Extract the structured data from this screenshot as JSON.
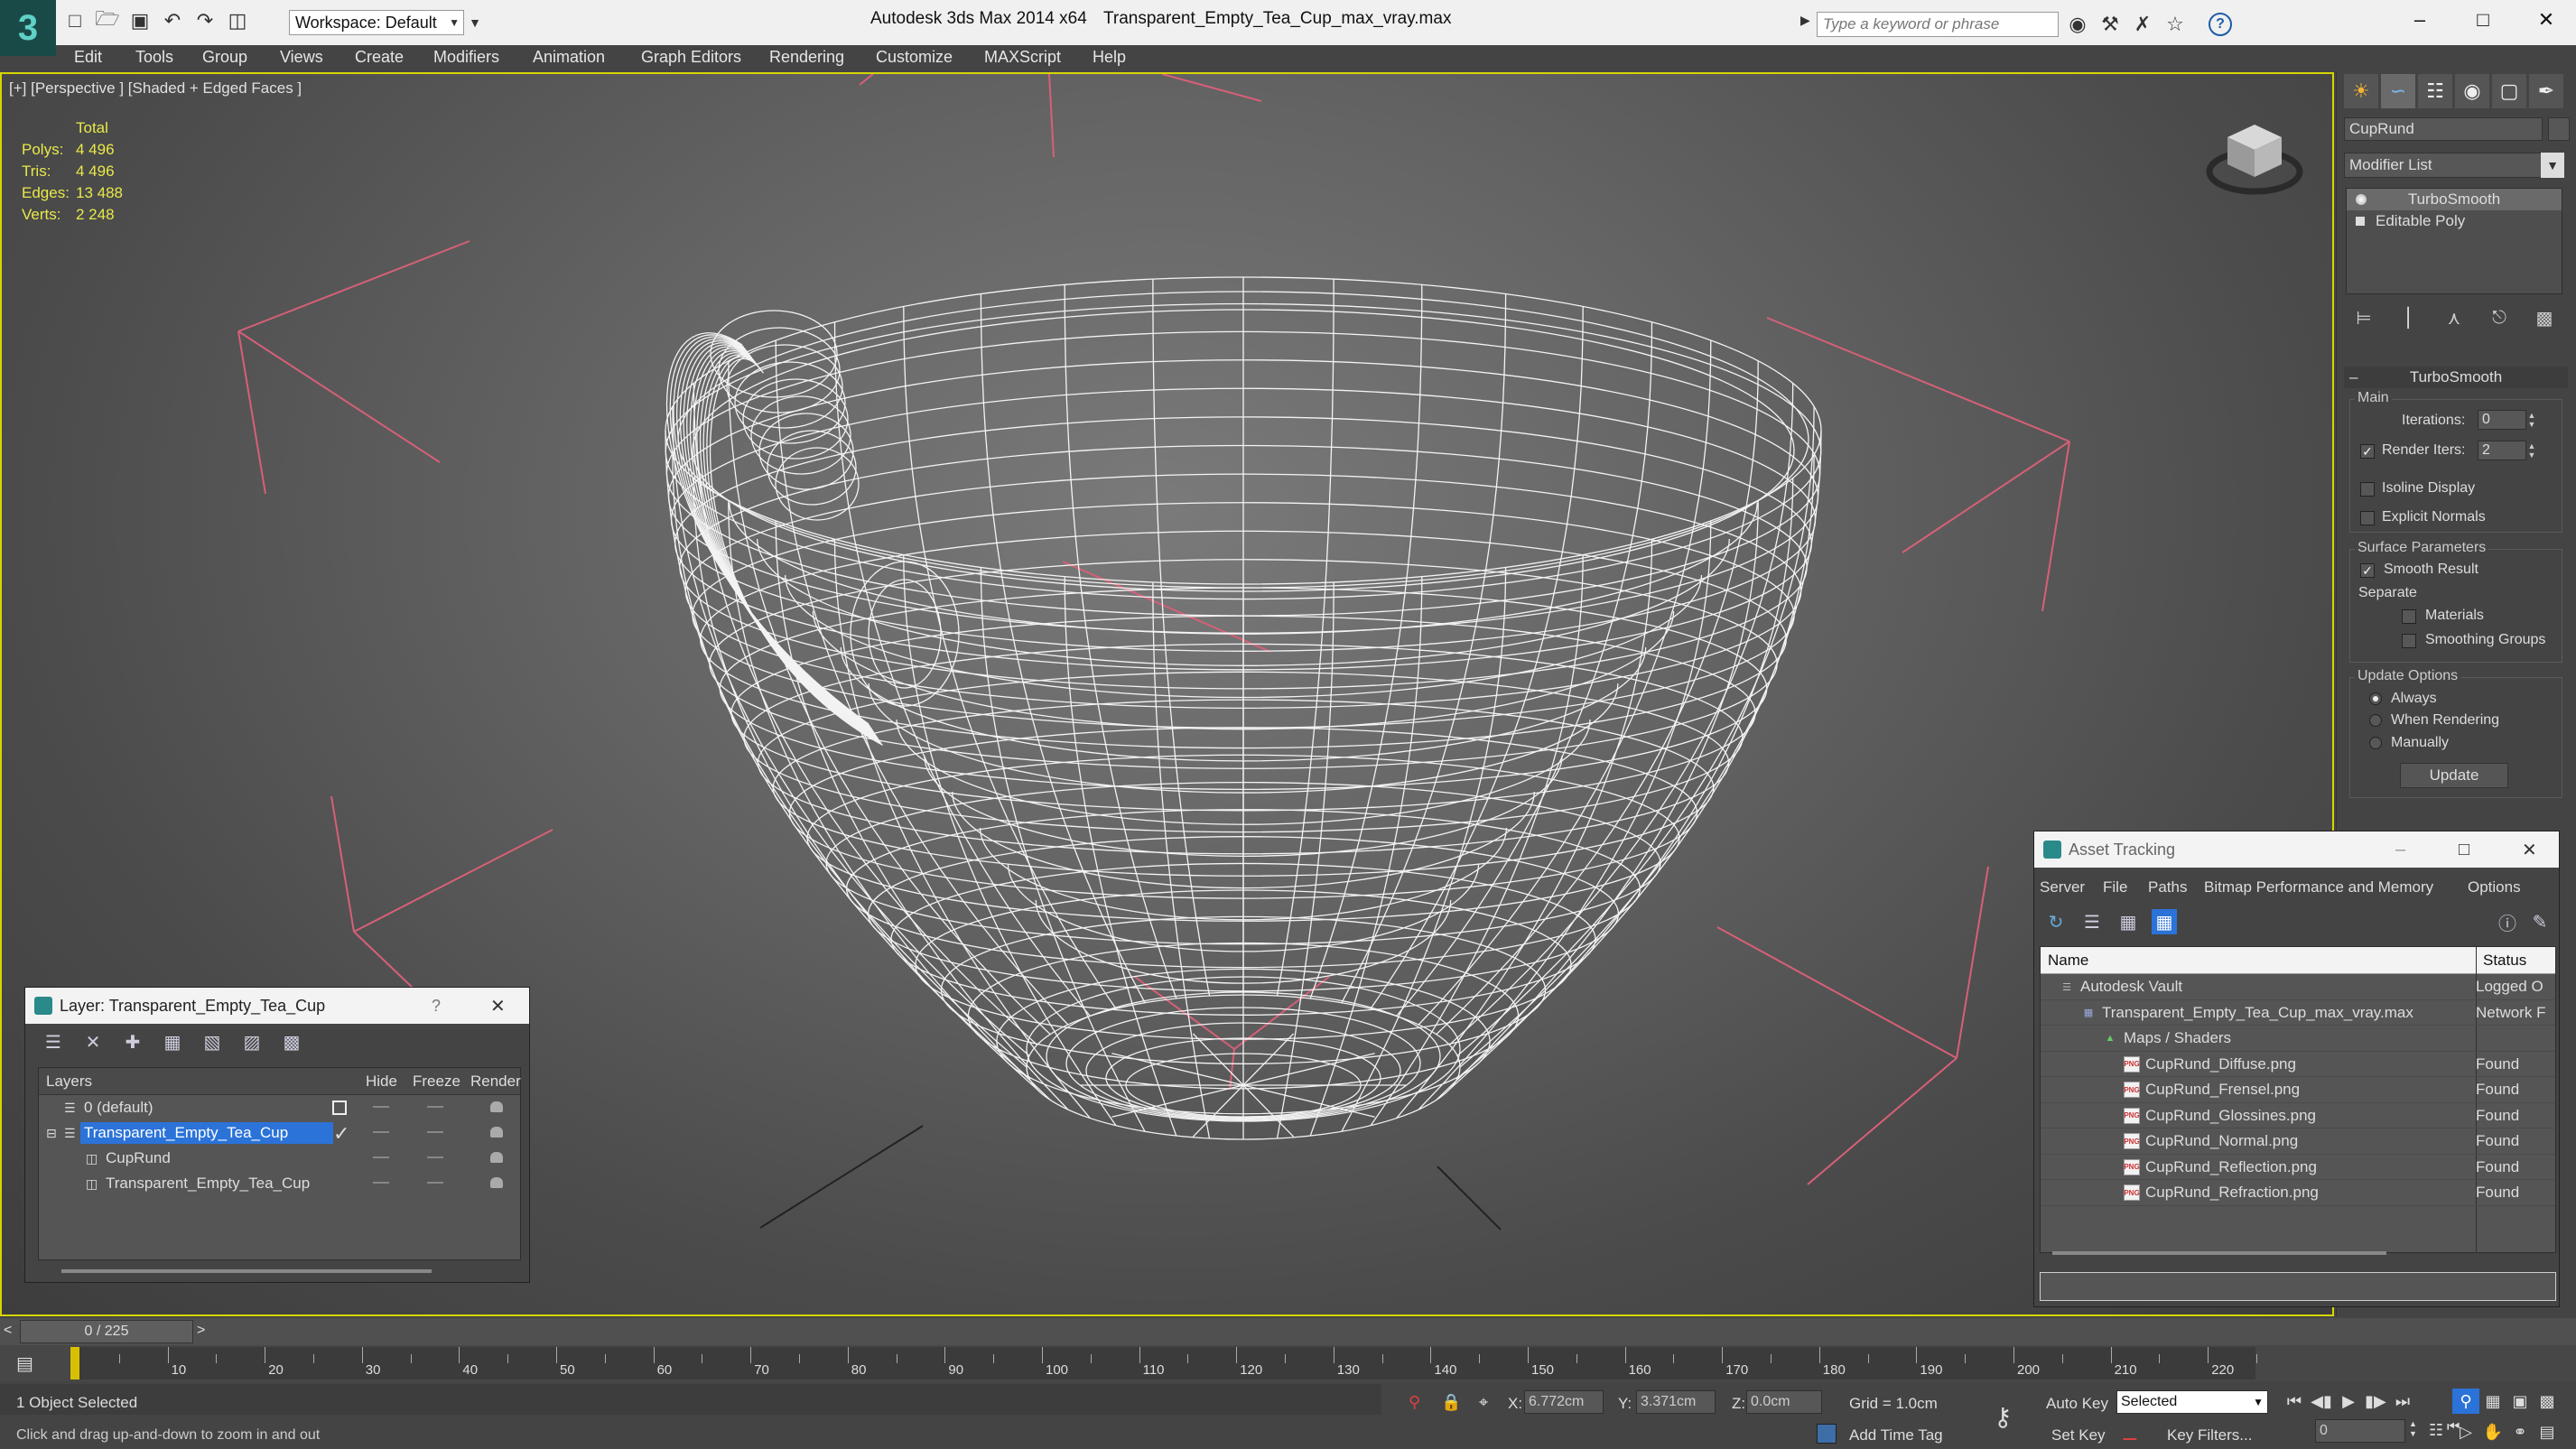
{
  "titlebar": {
    "workspace": "Workspace: Default",
    "app_title": "Autodesk 3ds Max  2014 x64",
    "file_title": "Transparent_Empty_Tea_Cup_max_vray.max",
    "search_placeholder": "Type a keyword or phrase"
  },
  "menu": [
    "Edit",
    "Tools",
    "Group",
    "Views",
    "Create",
    "Modifiers",
    "Animation",
    "Graph Editors",
    "Rendering",
    "Customize",
    "MAXScript",
    "Help"
  ],
  "viewport": {
    "label": "[+] [Perspective ] [Shaded + Edged Faces ]",
    "stats": {
      "total_label": "Total",
      "rows": [
        {
          "label": "Polys:",
          "value": "4 496"
        },
        {
          "label": "Tris:",
          "value": "4 496"
        },
        {
          "label": "Edges:",
          "value": "13 488"
        },
        {
          "label": "Verts:",
          "value": "2 248"
        }
      ]
    }
  },
  "command_panel": {
    "object_name": "CupRund",
    "modifier_list": "Modifier List",
    "stack": [
      "TurboSmooth",
      "Editable Poly"
    ],
    "rollout_title": "TurboSmooth",
    "main_group": "Main",
    "iterations_label": "Iterations:",
    "iterations_value": "0",
    "render_iters_label": "Render Iters:",
    "render_iters_value": "2",
    "render_iters_checked": true,
    "isoline_label": "Isoline Display",
    "explicit_normals_label": "Explicit Normals",
    "surface_group": "Surface Parameters",
    "smooth_result_label": "Smooth Result",
    "separate_label": "Separate",
    "materials_label": "Materials",
    "smoothing_groups_label": "Smoothing Groups",
    "update_group": "Update Options",
    "always_label": "Always",
    "when_rendering_label": "When Rendering",
    "manually_label": "Manually",
    "update_button": "Update"
  },
  "layer_window": {
    "title": "Layer: Transparent_Empty_Tea_Cup",
    "help": "?",
    "columns": {
      "layers": "Layers",
      "hide": "Hide",
      "freeze": "Freeze",
      "render": "Render"
    },
    "rows": [
      {
        "name": "0 (default)",
        "indent": 0
      },
      {
        "name": "Transparent_Empty_Tea_Cup",
        "indent": 0
      },
      {
        "name": "CupRund",
        "indent": 1
      },
      {
        "name": "Transparent_Empty_Tea_Cup",
        "indent": 1
      }
    ]
  },
  "asset_window": {
    "title": "Asset Tracking",
    "menu": [
      "Server",
      "File",
      "Paths",
      "Bitmap Performance and Memory",
      "Options"
    ],
    "columns": {
      "name": "Name",
      "status": "Status"
    },
    "rows": [
      {
        "name": "Autodesk Vault",
        "status": "Logged O",
        "indent": 0,
        "icon": "vault"
      },
      {
        "name": "Transparent_Empty_Tea_Cup_max_vray.max",
        "status": "Network F",
        "indent": 1,
        "icon": "max"
      },
      {
        "name": "Maps / Shaders",
        "status": "",
        "indent": 2,
        "icon": "maps"
      },
      {
        "name": "CupRund_Diffuse.png",
        "status": "Found",
        "indent": 3,
        "icon": "png"
      },
      {
        "name": "CupRund_Frensel.png",
        "status": "Found",
        "indent": 3,
        "icon": "png"
      },
      {
        "name": "CupRund_Glossines.png",
        "status": "Found",
        "indent": 3,
        "icon": "png"
      },
      {
        "name": "CupRund_Normal.png",
        "status": "Found",
        "indent": 3,
        "icon": "png"
      },
      {
        "name": "CupRund_Reflection.png",
        "status": "Found",
        "indent": 3,
        "icon": "png"
      },
      {
        "name": "CupRund_Refraction.png",
        "status": "Found",
        "indent": 3,
        "icon": "png"
      }
    ]
  },
  "timeline": {
    "frame_display": "0 / 225",
    "ticks": [
      "10",
      "20",
      "30",
      "40",
      "50",
      "60",
      "70",
      "80",
      "90",
      "100",
      "110",
      "120",
      "130",
      "140",
      "150",
      "160",
      "170",
      "180",
      "190",
      "200",
      "210",
      "220"
    ]
  },
  "status": {
    "selection": "1 Object Selected",
    "prompt": "Click and drag up-and-down to zoom in and out",
    "x_label": "X:",
    "x_value": "6.772cm",
    "y_label": "Y:",
    "y_value": "3.371cm",
    "z_label": "Z:",
    "z_value": "0.0cm",
    "grid": "Grid = 1.0cm",
    "add_time_tag": "Add Time Tag",
    "auto_key": "Auto Key",
    "set_key": "Set Key",
    "key_mode": "Selected",
    "key_filters": "Key Filters...",
    "frame_value": "0"
  },
  "colors": {
    "accent": "#2b73d8",
    "viewport_border": "#d6d600",
    "stats_text": "#e8e84a",
    "wire": "#ffffff",
    "grid_red": "#d66078"
  }
}
